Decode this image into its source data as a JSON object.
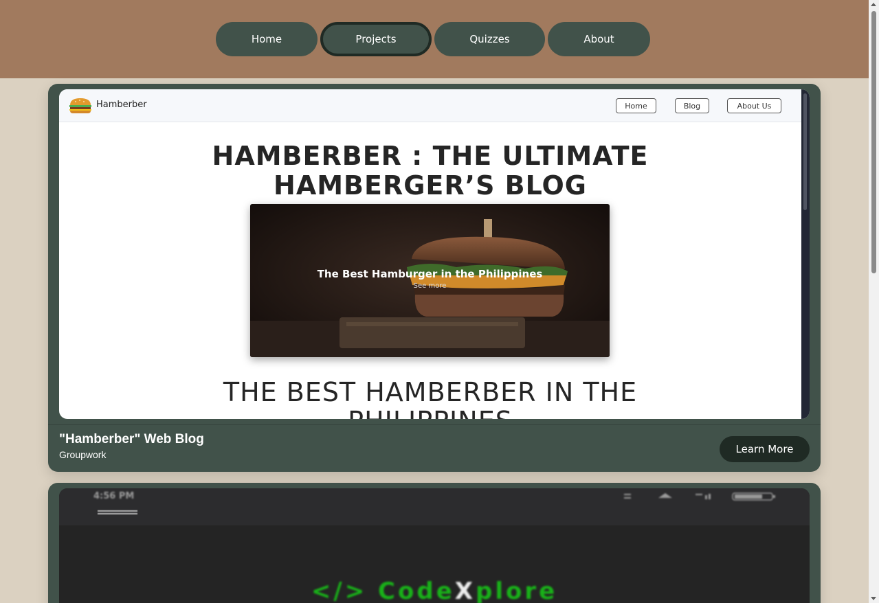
{
  "nav": {
    "items": [
      {
        "label": "Home"
      },
      {
        "label": "Projects",
        "active": true
      },
      {
        "label": "Quizzes"
      },
      {
        "label": "About"
      }
    ]
  },
  "projects": [
    {
      "title": "\"Hamberber\" Web Blog",
      "subtitle": "Groupwork",
      "button": "Learn More",
      "preview": {
        "site_name": "Hamberber",
        "site_nav": [
          "Home",
          "Blog",
          "About Us"
        ],
        "heading_line1": "HAMBERBER : THE ULTIMATE",
        "heading_line2": "HAMBERGER’S BLOG",
        "hero_caption": "The Best Hamburger in the Philippines",
        "hero_sub": "See more",
        "section_title_line1": "THE BEST HAMBERBER IN THE",
        "section_title_line2": "PHILIPPINES"
      }
    },
    {
      "preview": {
        "status_time": "4:56 PM",
        "status_icons": "",
        "logo_left": "</> Code",
        "logo_x": "X",
        "logo_right": "plore"
      }
    }
  ],
  "colors": {
    "header_bg": "#a17a5e",
    "page_bg": "#dbd1c1",
    "card_bg": "#41524a",
    "button_dark": "#1f2a24",
    "code_green": "#19b119"
  }
}
